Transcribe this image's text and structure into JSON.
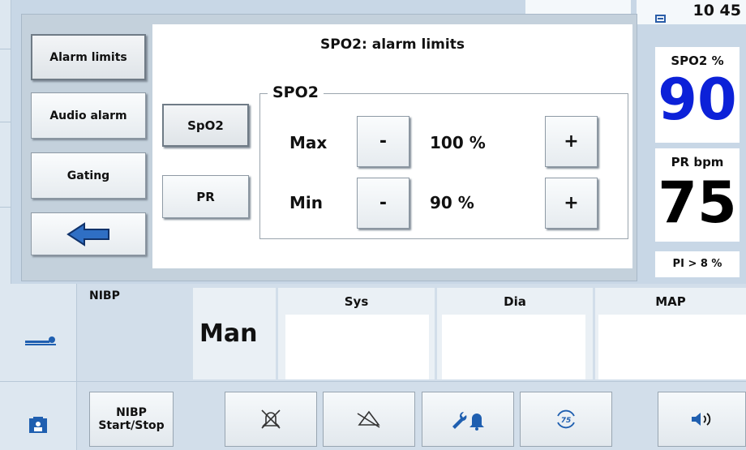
{
  "header": {
    "clock": "10 45"
  },
  "vitals": {
    "spo2_label": "SPO2 %",
    "spo2_value": "90",
    "pr_label": "PR bpm",
    "pr_value": "75",
    "pi_label": "PI > 8 %",
    "spo2_color": "#0c21d8",
    "pr_color": "#000000"
  },
  "dialog": {
    "title": "SPO2: alarm limits",
    "side_buttons": [
      "Alarm limits",
      "Audio alarm",
      "Gating"
    ],
    "param_buttons": [
      "SpO2",
      "PR"
    ],
    "group_title": "SPO2",
    "rows": [
      {
        "label": "Max",
        "value": "100 %",
        "minus": "-",
        "plus": "+"
      },
      {
        "label": "Min",
        "value": "90 %",
        "minus": "-",
        "plus": "+"
      }
    ],
    "back_icon": "left-arrow-icon"
  },
  "nibp": {
    "label": "NIBP",
    "mode": "Man",
    "columns": [
      "Sys",
      "Dia",
      "MAP"
    ],
    "patient_icon": "patient-lying-icon"
  },
  "bottom_bar": {
    "nibp_button": "NIBP\nStart/Stop",
    "icons": [
      "alarm-off-icon",
      "alarm-pause-icon",
      "wrench-bell-icon",
      "heart-rate-sync-icon",
      "speaker-icon"
    ],
    "left_icon": "patient-folder-icon"
  },
  "colors": {
    "accent": "#1f5fb0",
    "background": "#c8d7e6"
  }
}
